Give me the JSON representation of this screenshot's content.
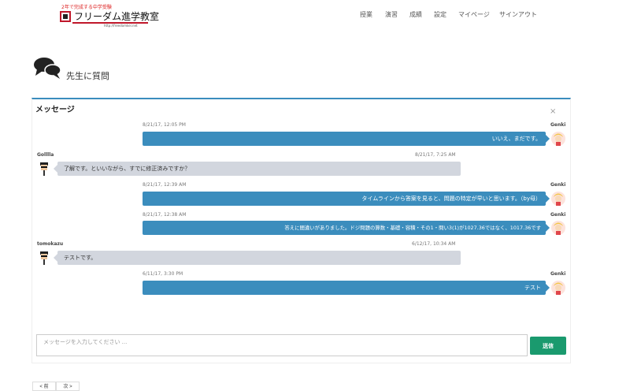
{
  "header": {
    "logo_tagline": "2年で完成する中学受験",
    "logo_title": "フリーダム進学教室",
    "logo_url": "http://freedomkei.net",
    "nav": [
      "授業",
      "演習",
      "成績",
      "設定",
      "マイページ",
      "サインアウト"
    ]
  },
  "page": {
    "title": "先生に質問",
    "icon": "comments-icon"
  },
  "panel": {
    "title": "メッセージ",
    "close": "×"
  },
  "messages": [
    {
      "side": "right",
      "name": "Genki",
      "time": "8/21/17, 12:05 PM",
      "text": "いいえ、まだです。"
    },
    {
      "side": "left",
      "name": "Golllla",
      "time": "8/21/17, 7:25 AM",
      "text": "了解です。といいながら、すでに修正済みですか？"
    },
    {
      "side": "right",
      "name": "Genki",
      "time": "8/21/17, 12:39 AM",
      "text": "タイムラインから答案を見ると、問題の特定が早いと思います。（by母）"
    },
    {
      "side": "right",
      "name": "Genki",
      "time": "8/21/17, 12:38 AM",
      "text": "答えに間違いがありました。ドジ問題の算数・基礎・容積・その1・問い3(1)が1027.36ではなく、1017.36です"
    },
    {
      "side": "left",
      "name": "tomokazu",
      "time": "6/12/17, 10:34 AM",
      "text": "テストです。"
    },
    {
      "side": "right",
      "name": "Genki",
      "time": "6/11/17, 3:30 PM",
      "text": "テスト"
    }
  ],
  "composer": {
    "placeholder": "メッセージを入力してください ...",
    "send_label": "送信"
  },
  "pager": {
    "prev": "< 前",
    "next": "次 >"
  },
  "colors": {
    "accent": "#3b8dbd",
    "send": "#1a9a6e",
    "logo_red": "#c0182b",
    "left_bubble": "#d2d6de"
  }
}
